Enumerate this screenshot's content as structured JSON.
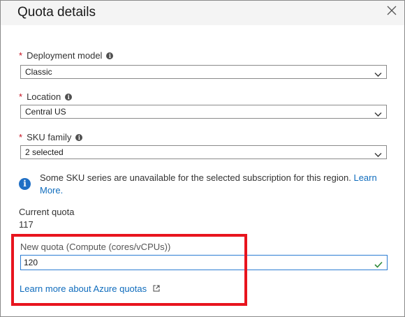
{
  "panel": {
    "title": "Quota details"
  },
  "fields": [
    {
      "label": "Deployment model",
      "required_mark": "*",
      "value": "Classic"
    },
    {
      "label": "Location",
      "required_mark": "*",
      "value": "Central US"
    },
    {
      "label": "SKU family",
      "required_mark": "*",
      "value": "2 selected"
    }
  ],
  "info": {
    "message": "Some SKU series are unavailable for the selected subscription for this region.",
    "link_text_1": "Learn",
    "link_text_2": "More."
  },
  "current_quota": {
    "label": "Current quota",
    "value": "117"
  },
  "new_quota": {
    "label": "New quota (Compute (cores/vCPUs))",
    "value": "120"
  },
  "learn_more": {
    "label": "Learn more about Azure quotas"
  },
  "colors": {
    "accent": "#0f6cbd",
    "required": "#c50f1f",
    "highlight": "#e8141e",
    "valid": "#2f8a3a"
  },
  "icons": {
    "close": "close-icon",
    "info": "info-icon",
    "chevron": "chevron-down-icon",
    "check": "checkmark-icon",
    "external": "external-link-icon"
  }
}
